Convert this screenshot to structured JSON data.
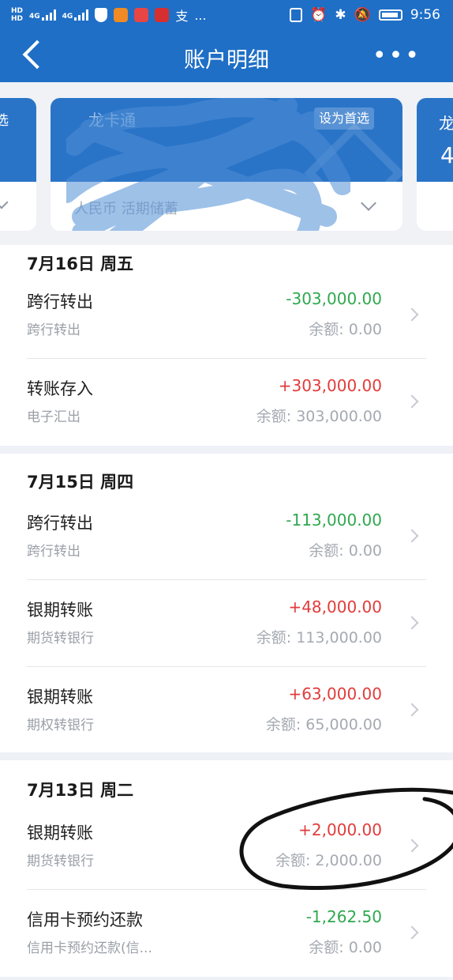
{
  "status_bar": {
    "left": {
      "hd1": "HD",
      "hd2": "HD",
      "net1": "4G",
      "net2": "4G",
      "more": "..."
    },
    "right": {
      "time": "9:56"
    },
    "icons": [
      "nfc-icon",
      "alarm-icon",
      "bluetooth-icon",
      "mute-icon",
      "battery-icon"
    ]
  },
  "nav": {
    "title": "账户明细",
    "back_icon": "back-arrow-icon",
    "more_icon": "more-icon"
  },
  "account_card": {
    "badge": "设为首选",
    "name_partial": "龙卡通",
    "currency_type": "人民币 活期储蓄",
    "right_card_glyph": "龙",
    "right_card_num": "4",
    "left_card_text": "选"
  },
  "sections": [
    {
      "date": "7月16日 周五",
      "rows": [
        {
          "title": "跨行转出",
          "sub": "跨行转出",
          "amount": "-303,000.00",
          "sign": "neg",
          "balance": "余额: 0.00"
        },
        {
          "title": "转账存入",
          "sub": "电子汇出",
          "amount": "+303,000.00",
          "sign": "pos",
          "balance": "余额: 303,000.00"
        }
      ]
    },
    {
      "date": "7月15日 周四",
      "rows": [
        {
          "title": "跨行转出",
          "sub": "跨行转出",
          "amount": "-113,000.00",
          "sign": "neg",
          "balance": "余额: 0.00"
        },
        {
          "title": "银期转账",
          "sub": "期货转银行",
          "amount": "+48,000.00",
          "sign": "pos",
          "balance": "余额: 113,000.00"
        },
        {
          "title": "银期转账",
          "sub": "期权转银行",
          "amount": "+63,000.00",
          "sign": "pos",
          "balance": "余额: 65,000.00"
        }
      ]
    },
    {
      "date": "7月13日 周二",
      "rows": [
        {
          "title": "银期转账",
          "sub": "期货转银行",
          "amount": "+2,000.00",
          "sign": "pos",
          "balance": "余额: 2,000.00"
        },
        {
          "title": "信用卡预约还款",
          "sub": "信用卡预约还款(信...",
          "amount": "-1,262.50",
          "sign": "neg",
          "balance": "余额: 0.00"
        }
      ]
    }
  ],
  "colors": {
    "header": "#1f6fc6",
    "positive": "#e23b3b",
    "negative": "#2fa84f"
  }
}
